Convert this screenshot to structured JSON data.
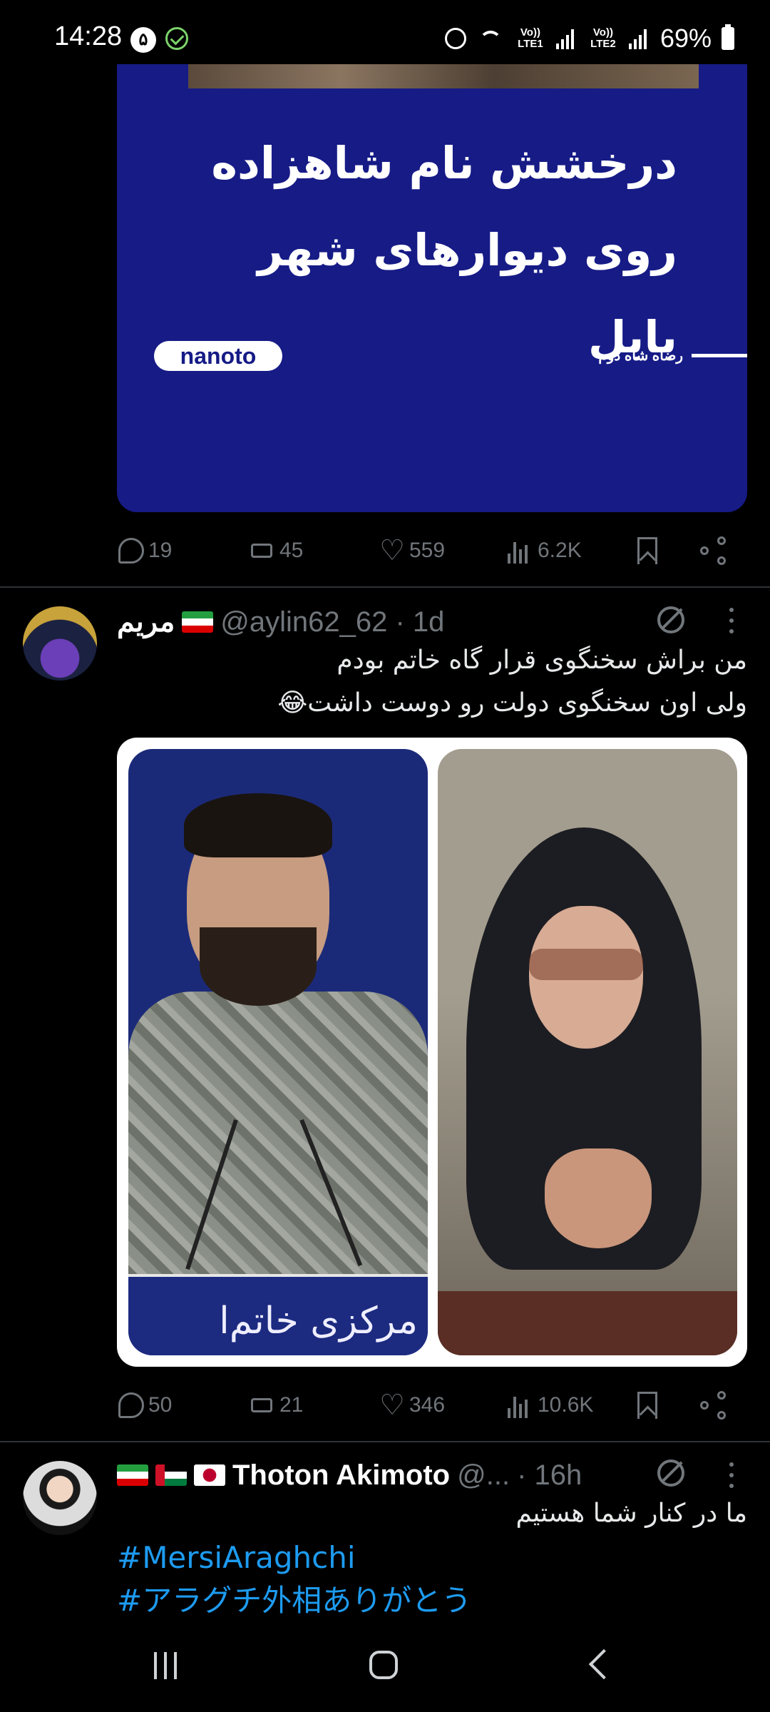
{
  "status_bar": {
    "time": "14:28",
    "notification_badge": "۵",
    "sim1": "Vo)) LTE1",
    "sim2": "Vo)) LTE2",
    "battery": "69%"
  },
  "tweet1": {
    "headline_line1": "درخشش نام شاهزاده",
    "headline_line2": "روی دیوارهای شهر بابل",
    "logo": "nanoto",
    "caption": "رضاه شاه دوم",
    "card_bg": "#161b86",
    "stats": {
      "replies": "19",
      "reposts": "45",
      "likes": "559",
      "views": "6.2K"
    }
  },
  "tweet2": {
    "display_name": "مریم",
    "handle_time": "@aylin62_62 · 1d",
    "text_line1": "من براش سخنگوی قرار گاه خاتم بودم",
    "text_line2": "ولی اون سخنگوی دولت رو دوست داشت😂",
    "photo_left_sign": "مرکزی خاتم‌ا",
    "stats": {
      "replies": "50",
      "reposts": "21",
      "likes": "346",
      "views": "10.6K"
    }
  },
  "tweet3": {
    "display_name": "Thoton Akimoto",
    "handle": "@...",
    "time": "· 16h",
    "text": "ما در کنار شما هستیم",
    "hashtag1": "#MersiAraghchi",
    "hashtag2": "#アラグチ外相ありがとう"
  },
  "colors": {
    "background": "#000000",
    "text": "#e7e9ea",
    "muted": "#71767b",
    "link": "#1d9bf0",
    "divider": "#2f3336"
  },
  "icons": [
    "reply-icon",
    "repost-icon",
    "like-icon",
    "views-icon",
    "bookmark-icon",
    "share-icon",
    "grok-icon",
    "more-icon"
  ]
}
